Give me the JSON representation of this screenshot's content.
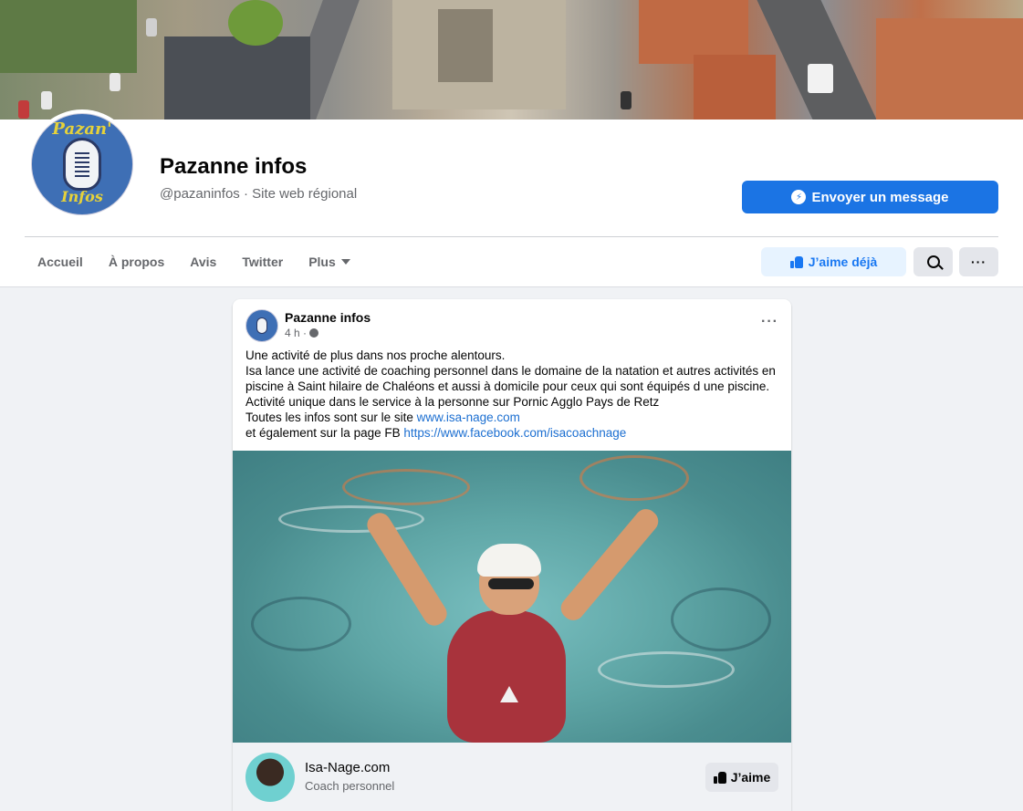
{
  "page": {
    "name": "Pazanne infos",
    "subtitle": "@pazaninfos · Site web régional",
    "avatar_text_top": "Pazan'",
    "avatar_text_bottom": "Infos",
    "message_button": "Envoyer un message"
  },
  "nav": {
    "items": [
      {
        "label": "Accueil"
      },
      {
        "label": "À propos"
      },
      {
        "label": "Avis"
      },
      {
        "label": "Twitter"
      },
      {
        "label": "Plus"
      }
    ],
    "like_button": "J’aime déjà",
    "more_button": "···"
  },
  "post": {
    "author": "Pazanne infos",
    "time": "4 h ·",
    "more": "···",
    "lines": [
      "Une activité de plus dans nos proche alentours.",
      "Isa lance une activité de coaching personnel dans le domaine de la natation et autres activités en",
      "piscine à Saint hilaire de Chaléons et aussi à domicile pour ceux qui sont équipés d une piscine.",
      "Activité unique dans le service à la personne sur Pornic Agglo Pays de Retz"
    ],
    "site_line_prefix": "Toutes les infos sont sur le site ",
    "site_link": "www.isa-nage.com",
    "fb_line_prefix": "et également sur la page FB ",
    "fb_link": "https://www.facebook.com/isacoachnage",
    "link_preview": {
      "title": "Isa-Nage.com",
      "subtitle": "Coach personnel",
      "button": "J’aime"
    }
  },
  "colors": {
    "primary": "#1b74e4",
    "like_bg": "#e7f3ff",
    "link": "#1c6fd1"
  }
}
